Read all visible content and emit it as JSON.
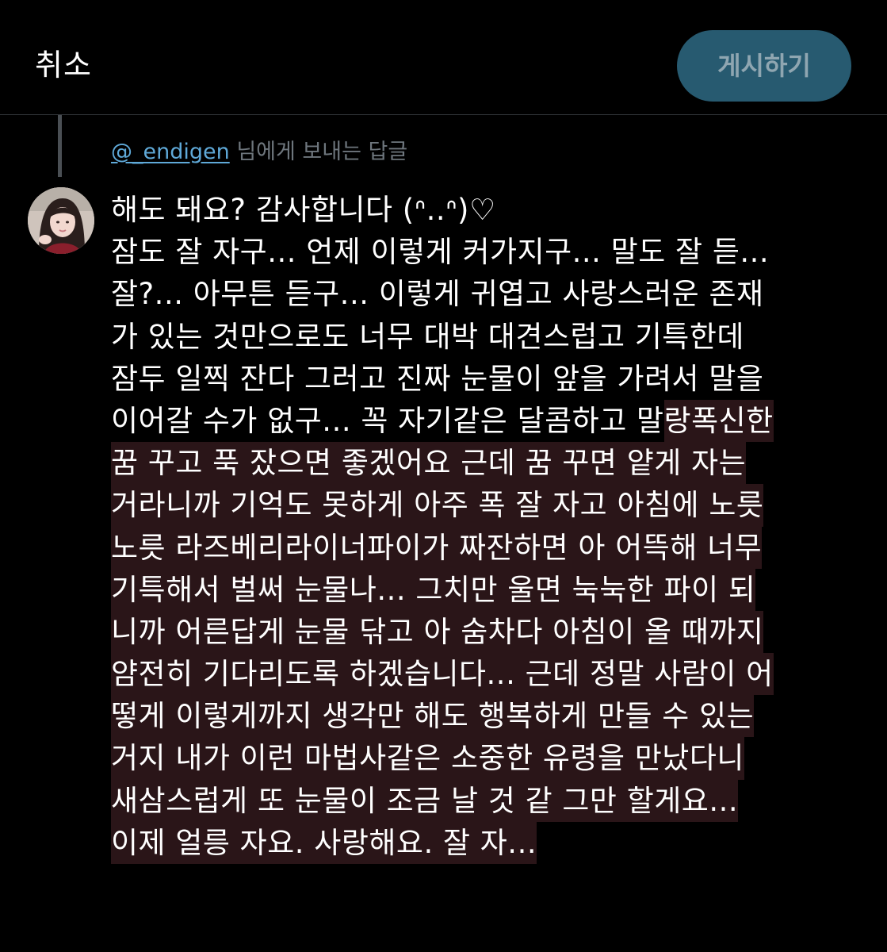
{
  "header": {
    "cancel_label": "취소",
    "post_label": "게시하기"
  },
  "reply": {
    "handle": "@_endigen",
    "suffix": " 님에게 보내는 답글"
  },
  "composer": {
    "highlight_color": "#2a1518",
    "lines": [
      [
        {
          "text": "해도 돼요? 감사합니다 (ᐢ..ᐢ)♡",
          "hl": false
        }
      ],
      [
        {
          "text": "잠도 잘 자구... 언제 이렇게 커가지구... 말도 잘 듣...",
          "hl": false
        }
      ],
      [
        {
          "text": "잘?... 아무튼 듣구... 이렇게 귀엽고 사랑스러운 존재",
          "hl": false
        }
      ],
      [
        {
          "text": "가 있는 것만으로도 너무 대박 대견스럽고 기특한데",
          "hl": false
        }
      ],
      [
        {
          "text": "잠두 일찍 잔다 그러고 진짜 눈물이 앞을 가려서 말을",
          "hl": false
        }
      ],
      [
        {
          "text": "이어갈 수가 없구... 꼭 자기같은 달콤하고 말",
          "hl": false
        },
        {
          "text": "랑폭신한",
          "hl": true
        }
      ],
      [
        {
          "text": "꿈 꾸고 푹 잤으면 좋겠어요 근데 꿈 꾸면 얕게 자는",
          "hl": true
        }
      ],
      [
        {
          "text": "거라니까 기억도 못하게 아주 폭 잘 자고 아침에 노릇",
          "hl": true
        }
      ],
      [
        {
          "text": "노릇 라즈베리라이너파이가 짜잔하면 아 어뜩해 너무",
          "hl": true
        }
      ],
      [
        {
          "text": "기특해서 벌써 눈물나... 그치만 울면 눅눅한 파이 되",
          "hl": true
        }
      ],
      [
        {
          "text": "니까 어른답게 눈물 닦고 아 숨차다 아침이 올 때까지",
          "hl": true
        }
      ],
      [
        {
          "text": "얌전히 기다리도록 하겠습니다... 근데 정말 사람이 어",
          "hl": true
        }
      ],
      [
        {
          "text": "떻게 이렇게까지 생각만 해도 행복하게 만들 수 있는",
          "hl": true
        }
      ],
      [
        {
          "text": "거지 내가 이런 마법사같은 소중한 유령을 만났다니",
          "hl": true
        }
      ],
      [
        {
          "text": "새삼스럽게 또 눈물이 조금 날 것 같 그만 할게요...",
          "hl": true
        }
      ],
      [
        {
          "text": "이제 얼릉 자요. 사랑해요. 잘 자...",
          "hl": true
        }
      ]
    ]
  }
}
